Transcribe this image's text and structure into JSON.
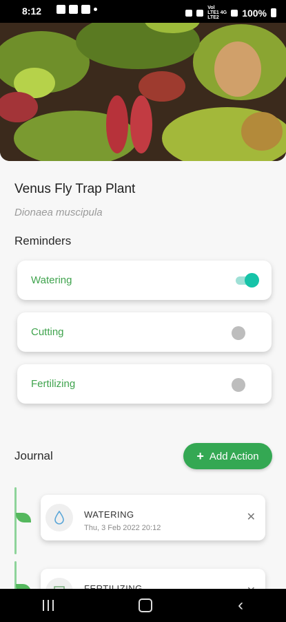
{
  "status_bar": {
    "time": "8:12",
    "signal_text": "Vol LTE1 4G LTE2",
    "battery": "100%"
  },
  "plant": {
    "name": "Venus Fly Trap Plant",
    "scientific_name": "Dionaea muscipula"
  },
  "reminders": {
    "heading": "Reminders",
    "items": [
      {
        "label": "Watering",
        "enabled": true
      },
      {
        "label": "Cutting",
        "enabled": false
      },
      {
        "label": "Fertilizing",
        "enabled": false
      }
    ]
  },
  "journal": {
    "heading": "Journal",
    "add_action_label": "Add Action",
    "entries": [
      {
        "type": "WATERING",
        "date": "Thu, 3 Feb 2022 20:12",
        "icon": "water-drop-icon"
      },
      {
        "type": "FERTILIZING",
        "date": "",
        "icon": "fertilizer-icon"
      }
    ]
  },
  "colors": {
    "accent_green": "#34a853",
    "toggle_on": "#16c3a8",
    "label_green": "#3fa34d"
  }
}
